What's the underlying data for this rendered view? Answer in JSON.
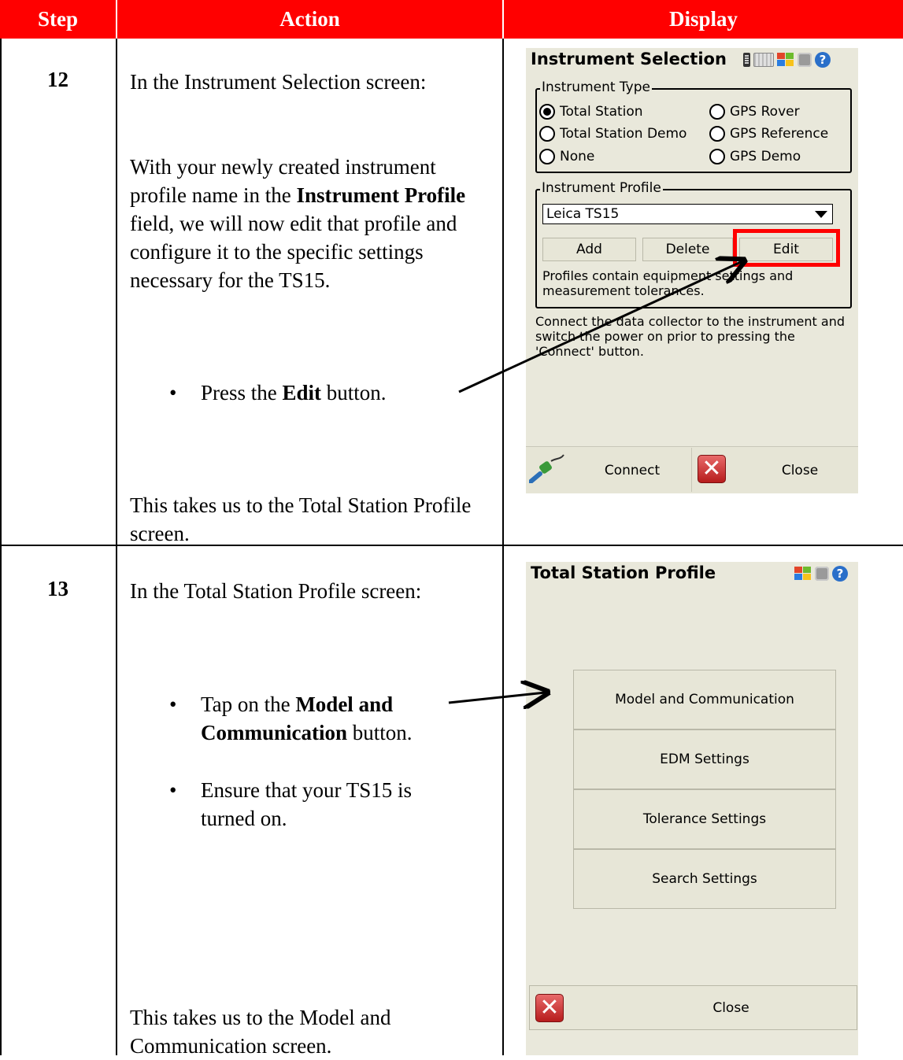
{
  "table": {
    "headers": {
      "step": "Step",
      "action": "Action",
      "display": "Display"
    }
  },
  "steps": [
    {
      "number": "12",
      "intro": "In the Instrument Selection screen:",
      "para_pre": "With your newly created instrument profile name in the ",
      "para_bold": "Instrument Profile",
      "para_post": " field, we will now edit that profile and configure it to the specific settings necessary for the TS15.",
      "bullet_pre": "Press the ",
      "bullet_bold": "Edit",
      "bullet_post": " button.",
      "outro": "This takes us to the Total Station Profile screen."
    },
    {
      "number": "13",
      "intro": "In the Total Station Profile screen:",
      "bullet1_pre": "Tap on the ",
      "bullet1_bold": "Model and Communication",
      "bullet1_post": " button.",
      "bullet2": "Ensure that your TS15 is turned on.",
      "outro": "This takes us to the Model and Communication screen."
    }
  ],
  "screen_instrument": {
    "title": "Instrument Selection",
    "type_legend": "Instrument Type",
    "radios": [
      {
        "label": "Total Station",
        "checked": true
      },
      {
        "label": "GPS Rover",
        "checked": false
      },
      {
        "label": "Total Station Demo",
        "checked": false
      },
      {
        "label": "GPS Reference",
        "checked": false
      },
      {
        "label": "None",
        "checked": false
      },
      {
        "label": "GPS Demo",
        "checked": false
      }
    ],
    "profile_legend": "Instrument Profile",
    "profile_value": "Leica TS15",
    "add": "Add",
    "delete": "Delete",
    "edit": "Edit",
    "profiles_note": "Profiles contain equipment settings and measurement tolerances.",
    "connect_note": "Connect the data collector to the instrument and switch the power on prior to pressing the 'Connect' button.",
    "connect": "Connect",
    "close": "Close",
    "highlight_color": "#ff0000"
  },
  "screen_profile": {
    "title": "Total Station Profile",
    "buttons": [
      "Model and Communication",
      "EDM Settings",
      "Tolerance Settings",
      "Search Settings"
    ],
    "close": "Close"
  },
  "icons": [
    "battery-icon",
    "keyboard-icon",
    "windows-start-icon",
    "grid-icon",
    "help-icon",
    "connect-cable-icon",
    "close-x-icon"
  ]
}
